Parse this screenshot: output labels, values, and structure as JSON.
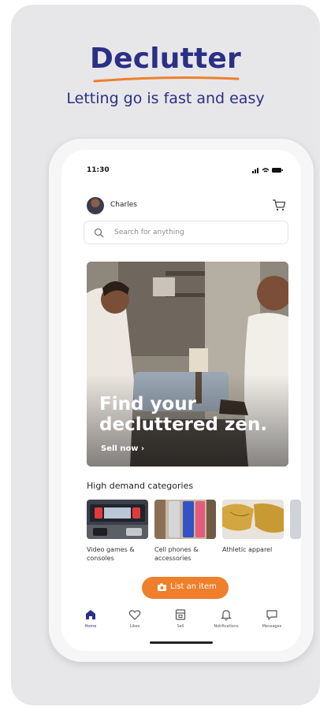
{
  "brand": {
    "name": "Declutter",
    "tagline": "Letting go is fast and easy",
    "colors": {
      "navy": "#2c2f86",
      "accent": "#ef7f2b"
    }
  },
  "status_bar": {
    "time": "11:30"
  },
  "header": {
    "user_name": "Charles",
    "cart_icon": "cart-icon"
  },
  "search": {
    "placeholder": "Search for anything"
  },
  "hero": {
    "title": "Find your decluttered zen.",
    "cta": "Sell now ›"
  },
  "categories": {
    "title": "High demand categories",
    "items": [
      {
        "label": "Video games & consoles"
      },
      {
        "label": "Cell phones & accessories"
      },
      {
        "label": "Athletic apparel"
      }
    ]
  },
  "list_button": {
    "label": "List an item"
  },
  "tabs": [
    {
      "label": "Home",
      "icon": "home-icon",
      "active": true
    },
    {
      "label": "Likes",
      "icon": "heart-icon",
      "active": false
    },
    {
      "label": "Sell",
      "icon": "sell-icon",
      "active": false
    },
    {
      "label": "Notifications",
      "icon": "bell-icon",
      "active": false
    },
    {
      "label": "Messages",
      "icon": "chat-icon",
      "active": false
    }
  ]
}
